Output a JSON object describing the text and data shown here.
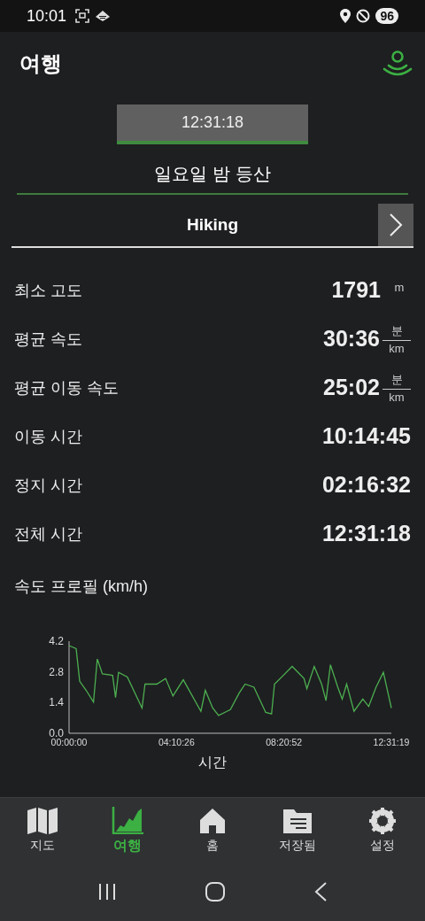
{
  "status_bar": {
    "time": "10:01",
    "battery": "96"
  },
  "header": {
    "title": "여행"
  },
  "timer": {
    "value": "12:31:18"
  },
  "trip": {
    "name": "일요일 밤 등산"
  },
  "activity": {
    "label": "Hiking"
  },
  "stats": [
    {
      "label": "최소 고도",
      "value": "1791",
      "kind": "unit",
      "unit": "m"
    },
    {
      "label": "평균 속도",
      "value": "30:36",
      "kind": "fraction",
      "unit_top": "분",
      "unit_bottom": "km"
    },
    {
      "label": "평균 이동 속도",
      "value": "25:02",
      "kind": "fraction",
      "unit_top": "분",
      "unit_bottom": "km"
    },
    {
      "label": "이동 시간",
      "value": "10:14:45",
      "kind": "plain"
    },
    {
      "label": "정지 시간",
      "value": "02:16:32",
      "kind": "plain"
    },
    {
      "label": "전체 시간",
      "value": "12:31:18",
      "kind": "plain"
    }
  ],
  "chart": {
    "chart_data": {
      "type": "line",
      "title": "속도 프로필 (km/h)",
      "xlabel": "시간",
      "x": [
        0,
        988,
        1482,
        2388,
        3417,
        3952,
        4652,
        6093,
        6505,
        6917,
        8152,
        10210,
        10622,
        12269,
        13504,
        14533,
        15974,
        18444,
        19062,
        20091,
        20914,
        22561,
        23796,
        24619,
        25854,
        27501,
        28324,
        28736,
        29971,
        31206,
        32853,
        33264,
        34294,
        35323,
        35941,
        36559,
        37588,
        38206,
        38824,
        39853,
        41088,
        41911,
        42940,
        43969,
        45079
      ],
      "series": [
        {
          "color": "#4caf50",
          "values": [
            4.0,
            3.86,
            2.37,
            1.96,
            1.42,
            3.39,
            2.71,
            2.64,
            1.63,
            2.78,
            2.57,
            1.15,
            2.24,
            2.24,
            2.5,
            1.7,
            2.44,
            1.0,
            1.96,
            1.15,
            0.81,
            1.08,
            1.83,
            2.24,
            2.1,
            0.95,
            0.88,
            2.24,
            2.64,
            3.05,
            2.5,
            2.03,
            3.05,
            2.24,
            1.49,
            3.12,
            2.1,
            1.56,
            2.24,
            1.0,
            1.56,
            1.22,
            2.1,
            2.78,
            1.15
          ]
        }
      ],
      "xlim": [
        0,
        45079
      ],
      "ylim": [
        0,
        4.2
      ],
      "xticks": [
        {
          "value": 0,
          "label": "00:00:00"
        },
        {
          "value": 15026,
          "label": "04:10:26"
        },
        {
          "value": 30052,
          "label": "08:20:52"
        },
        {
          "value": 45079,
          "label": "12:31:19"
        }
      ],
      "yticks": [
        {
          "value": 0,
          "label": "0.0"
        },
        {
          "value": 1.4,
          "label": "1.4"
        },
        {
          "value": 2.8,
          "label": "2.8"
        },
        {
          "value": 4.2,
          "label": "4.2"
        }
      ]
    }
  },
  "nav": [
    {
      "label": "지도",
      "selected": false
    },
    {
      "label": "여행",
      "selected": true
    },
    {
      "label": "홈",
      "selected": false
    },
    {
      "label": "저장됨",
      "selected": false
    },
    {
      "label": "설정",
      "selected": false
    }
  ]
}
